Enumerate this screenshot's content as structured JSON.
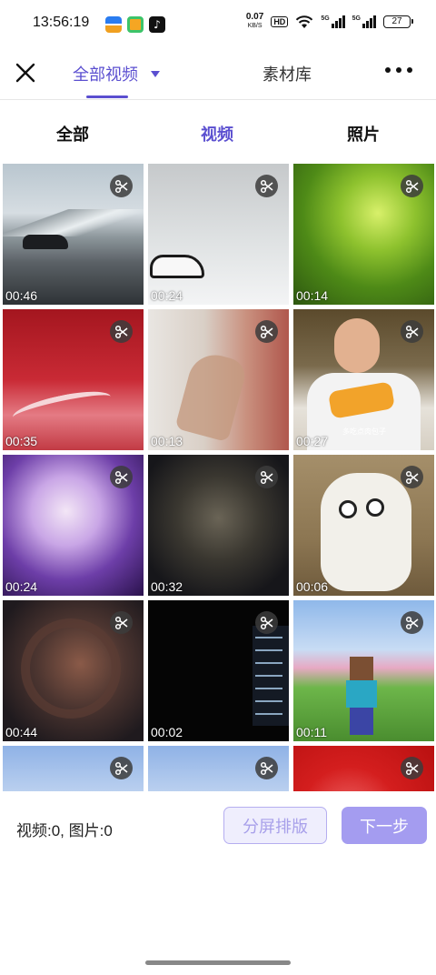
{
  "status_bar": {
    "time": "13:56:19",
    "net_speed": "0.07",
    "net_unit": "KB/S",
    "hd_label": "HD",
    "sig1_label": "5G",
    "sig2_label": "5G",
    "battery": "27",
    "icons": [
      "app-notification-icon",
      "app-store-icon",
      "tiktok-icon",
      "wifi-icon",
      "signal-icon",
      "battery-icon"
    ]
  },
  "header": {
    "close_icon": "close-icon",
    "tab_all_videos": "全部视频",
    "tab_library": "素材库",
    "more_icon": "more-icon",
    "accent": "#5b4fd0"
  },
  "filters": {
    "all": "全部",
    "videos": "视频",
    "photos": "照片",
    "active": "视频"
  },
  "grid": {
    "items": [
      {
        "duration": "00:46",
        "caption": ""
      },
      {
        "duration": "00:24",
        "caption": ""
      },
      {
        "duration": "00:14",
        "caption": ""
      },
      {
        "duration": "00:35",
        "caption": ""
      },
      {
        "duration": "00:13",
        "caption": ""
      },
      {
        "duration": "00:27",
        "caption": "多吃点肉包子"
      },
      {
        "duration": "00:24",
        "caption": ""
      },
      {
        "duration": "00:32",
        "caption": ""
      },
      {
        "duration": "00:06",
        "caption": ""
      },
      {
        "duration": "00:44",
        "caption": ""
      },
      {
        "duration": "00:02",
        "caption": ""
      },
      {
        "duration": "00:11",
        "caption": ""
      },
      {
        "duration": "",
        "caption": ""
      },
      {
        "duration": "",
        "caption": ""
      },
      {
        "duration": "",
        "caption": ""
      }
    ],
    "cut_icon": "scissors-icon"
  },
  "footer": {
    "counts": "视频:0, 图片:0",
    "split_label": "分屏排版",
    "next_label": "下一步"
  }
}
